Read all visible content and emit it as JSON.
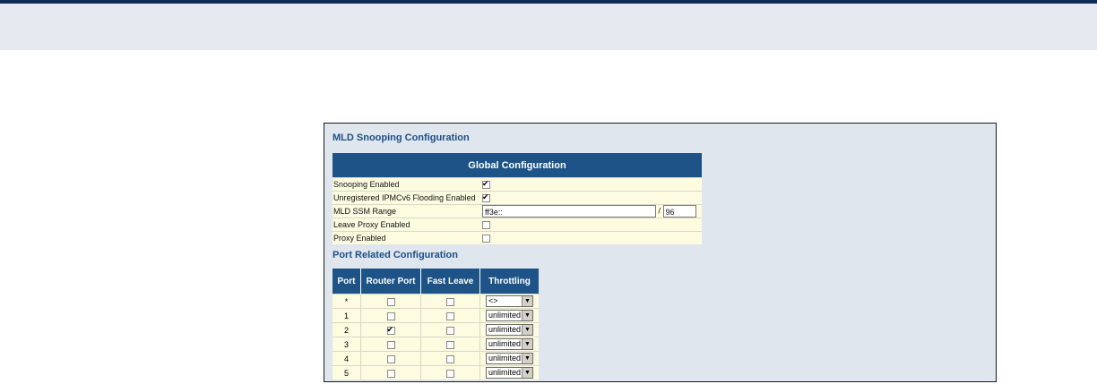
{
  "section_title": "MLD Snooping Configuration",
  "global": {
    "header": "Global Configuration",
    "rows": [
      {
        "label": "Snooping Enabled",
        "checked": true
      },
      {
        "label": "Unregistered IPMCv6 Flooding Enabled",
        "checked": true
      },
      {
        "label": "MLD SSM Range",
        "value": "ff3e::",
        "separator": "/",
        "prefix_len": "96"
      },
      {
        "label": "Leave Proxy Enabled",
        "checked": false
      },
      {
        "label": "Proxy Enabled",
        "checked": false
      }
    ]
  },
  "port_section_title": "Port Related Configuration",
  "ports": {
    "headers": [
      "Port",
      "Router Port",
      "Fast Leave",
      "Throttling"
    ],
    "rows": [
      {
        "port": "*",
        "router": false,
        "fast": false,
        "throttling": "<>"
      },
      {
        "port": "1",
        "router": false,
        "fast": false,
        "throttling": "unlimited"
      },
      {
        "port": "2",
        "router": true,
        "fast": false,
        "throttling": "unlimited"
      },
      {
        "port": "3",
        "router": false,
        "fast": false,
        "throttling": "unlimited"
      },
      {
        "port": "4",
        "router": false,
        "fast": false,
        "throttling": "unlimited"
      },
      {
        "port": "5",
        "router": false,
        "fast": false,
        "throttling": "unlimited"
      }
    ]
  },
  "colors": {
    "header_bg": "#1d5386",
    "row_bg": "#fdfbe0",
    "title": "#1e4f86",
    "panel_bg": "#dfe6ee"
  }
}
